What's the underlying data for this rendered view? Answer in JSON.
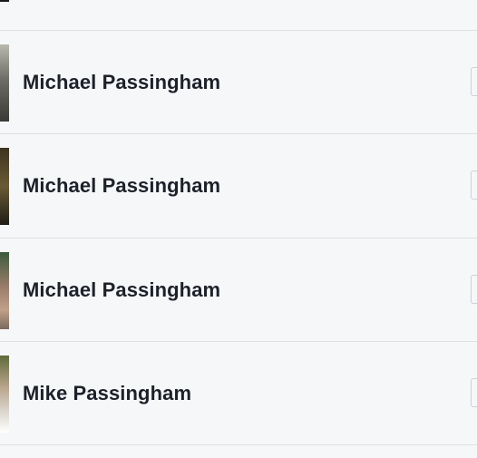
{
  "people": [
    {
      "name": "Michael Passingham"
    },
    {
      "name": "Michael Passingham"
    },
    {
      "name": "Michael Passingham"
    },
    {
      "name": "Mike Passingham"
    }
  ]
}
